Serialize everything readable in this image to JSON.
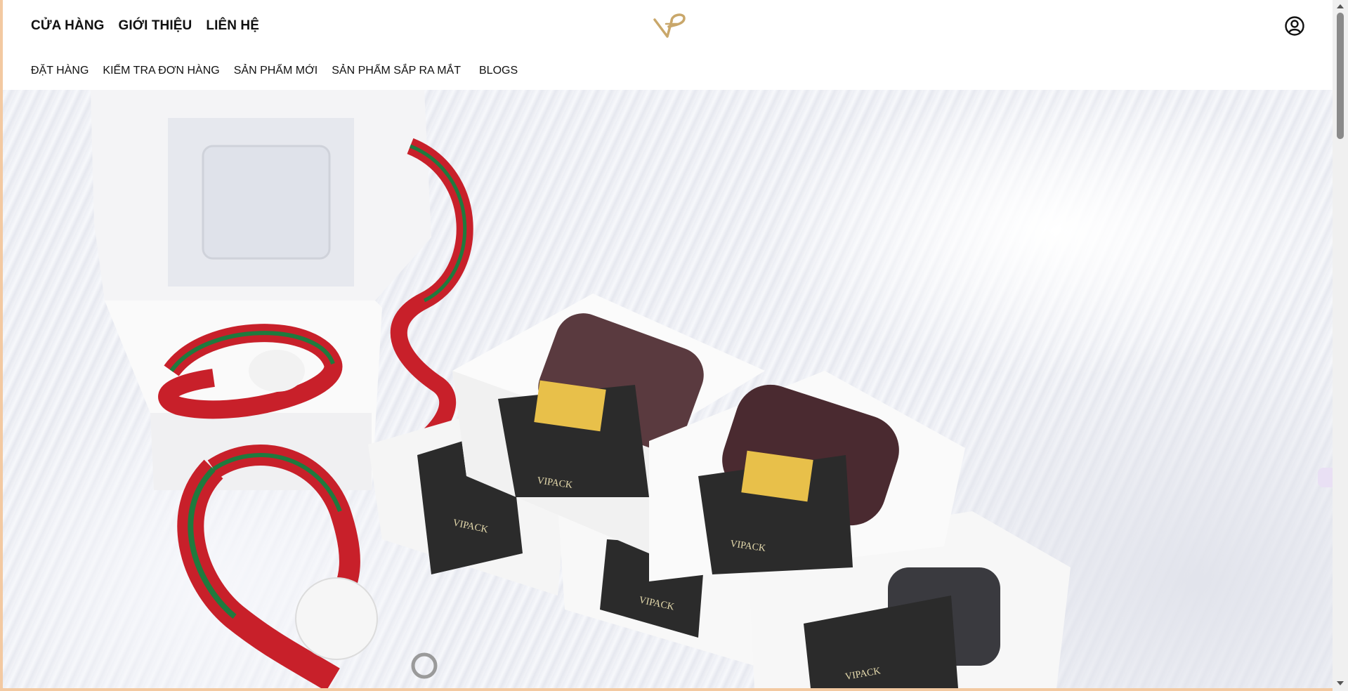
{
  "header": {
    "top_nav": [
      "CỬA HÀNG",
      "GIỚI THIỆU",
      "LIÊN HỆ"
    ],
    "sub_nav": [
      "ĐẶT HÀNG",
      "KIỂM TRA ĐƠN HÀNG",
      "SẢN PHẨM MỚI",
      "SẢN PHẨM SẮP RA MẮT",
      "BLOGS"
    ],
    "logo_icon": "vipack-logo-icon",
    "account_icon": "user-circle-icon"
  },
  "hero": {
    "box_brand": "VIPACK"
  },
  "colors": {
    "logo_gold": "#c9a76a",
    "lanyard_red": "#c8202a",
    "lanyard_green": "#1f7a3e",
    "box_band": "#2b2b2b"
  }
}
